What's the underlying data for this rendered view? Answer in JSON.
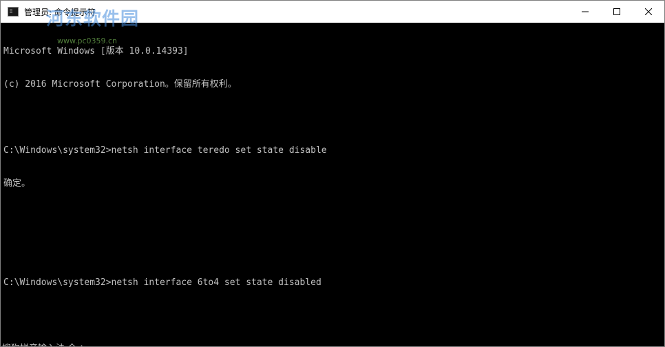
{
  "window": {
    "title": "管理员: 命令提示符",
    "app_icon": "cmd-icon",
    "controls": {
      "minimize_icon": "minimize-icon",
      "maximize_icon": "maximize-icon",
      "close_icon": "close-icon"
    }
  },
  "watermark": {
    "text": "河东软件园",
    "url": "www.pc0359.cn"
  },
  "console": {
    "lines": [
      "Microsoft Windows [版本 10.0.14393]",
      "(c) 2016 Microsoft Corporation。保留所有权利。",
      "",
      "C:\\Windows\\system32>netsh interface teredo set state disable",
      "确定。",
      "",
      "",
      "C:\\Windows\\system32>netsh interface 6to4 set state disabled"
    ]
  },
  "ime_bar": {
    "text": "搜狗拼音输入法 全 ："
  },
  "colors": {
    "console_bg": "#000000",
    "console_text": "#c0c0c0",
    "titlebar_bg": "#ffffff"
  }
}
